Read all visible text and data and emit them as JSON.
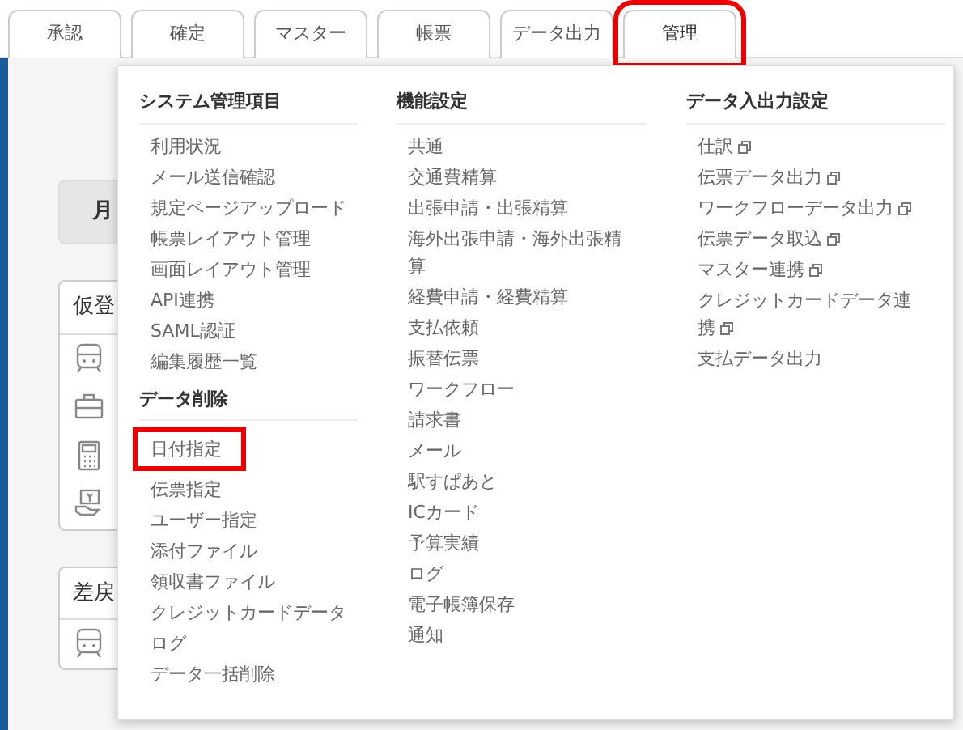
{
  "tabs": [
    {
      "label": "承認",
      "selected": false,
      "highlighted": false
    },
    {
      "label": "確定",
      "selected": false,
      "highlighted": false
    },
    {
      "label": "マスター",
      "selected": false,
      "highlighted": false
    },
    {
      "label": "帳票",
      "selected": false,
      "highlighted": false
    },
    {
      "label": "データ出力",
      "selected": false,
      "highlighted": false
    },
    {
      "label": "管理",
      "selected": true,
      "highlighted": true
    }
  ],
  "background": {
    "button": "月",
    "panels": [
      {
        "title": "仮登",
        "rows": [
          {
            "kind": "train"
          },
          {
            "kind": "briefcase"
          },
          {
            "kind": "calculator"
          },
          {
            "kind": "payment"
          }
        ]
      },
      {
        "title": "差戻",
        "rows": [
          {
            "kind": "train"
          }
        ]
      }
    ]
  },
  "menu": {
    "columns": [
      {
        "sections": [
          {
            "heading": "システム管理項目",
            "items": [
              {
                "label": "利用状況",
                "external": false,
                "highlighted": false
              },
              {
                "label": "メール送信確認",
                "external": false,
                "highlighted": false
              },
              {
                "label": "規定ページアップロード",
                "external": false,
                "highlighted": false
              },
              {
                "label": "帳票レイアウト管理",
                "external": false,
                "highlighted": false
              },
              {
                "label": "画面レイアウト管理",
                "external": false,
                "highlighted": false
              },
              {
                "label": "API連携",
                "external": false,
                "highlighted": false
              },
              {
                "label": "SAML認証",
                "external": false,
                "highlighted": false
              },
              {
                "label": "編集履歴一覧",
                "external": false,
                "highlighted": false
              }
            ]
          },
          {
            "heading": "データ削除",
            "items": [
              {
                "label": "日付指定",
                "external": false,
                "highlighted": true
              },
              {
                "label": "伝票指定",
                "external": false,
                "highlighted": false
              },
              {
                "label": "ユーザー指定",
                "external": false,
                "highlighted": false
              },
              {
                "label": "添付ファイル",
                "external": false,
                "highlighted": false
              },
              {
                "label": "領収書ファイル",
                "external": false,
                "highlighted": false
              },
              {
                "label": "クレジットカードデータ",
                "external": false,
                "highlighted": false
              },
              {
                "label": "ログ",
                "external": false,
                "highlighted": false
              },
              {
                "label": "データ一括削除",
                "external": false,
                "highlighted": false
              }
            ]
          }
        ]
      },
      {
        "sections": [
          {
            "heading": "機能設定",
            "items": [
              {
                "label": "共通",
                "external": false,
                "highlighted": false
              },
              {
                "label": "交通費精算",
                "external": false,
                "highlighted": false
              },
              {
                "label": "出張申請・出張精算",
                "external": false,
                "highlighted": false
              },
              {
                "label": "海外出張申請・海外出張精算",
                "external": false,
                "highlighted": false
              },
              {
                "label": "経費申請・経費精算",
                "external": false,
                "highlighted": false
              },
              {
                "label": "支払依頼",
                "external": false,
                "highlighted": false
              },
              {
                "label": "振替伝票",
                "external": false,
                "highlighted": false
              },
              {
                "label": "ワークフロー",
                "external": false,
                "highlighted": false
              },
              {
                "label": "請求書",
                "external": false,
                "highlighted": false
              },
              {
                "label": "メール",
                "external": false,
                "highlighted": false
              },
              {
                "label": "駅すぱあと",
                "external": false,
                "highlighted": false
              },
              {
                "label": "ICカード",
                "external": false,
                "highlighted": false
              },
              {
                "label": "予算実績",
                "external": false,
                "highlighted": false
              },
              {
                "label": "ログ",
                "external": false,
                "highlighted": false
              },
              {
                "label": "電子帳簿保存",
                "external": false,
                "highlighted": false
              },
              {
                "label": "通知",
                "external": false,
                "highlighted": false
              }
            ]
          }
        ]
      },
      {
        "sections": [
          {
            "heading": "データ入出力設定",
            "items": [
              {
                "label": "仕訳",
                "external": true,
                "highlighted": false
              },
              {
                "label": "伝票データ出力",
                "external": true,
                "highlighted": false
              },
              {
                "label": "ワークフローデータ出力",
                "external": true,
                "highlighted": false
              },
              {
                "label": "伝票データ取込",
                "external": true,
                "highlighted": false
              },
              {
                "label": "マスター連携",
                "external": true,
                "highlighted": false
              },
              {
                "label": "クレジットカードデータ連携",
                "external": true,
                "highlighted": false
              },
              {
                "label": "支払データ出力",
                "external": false,
                "highlighted": false
              }
            ]
          }
        ]
      }
    ]
  }
}
